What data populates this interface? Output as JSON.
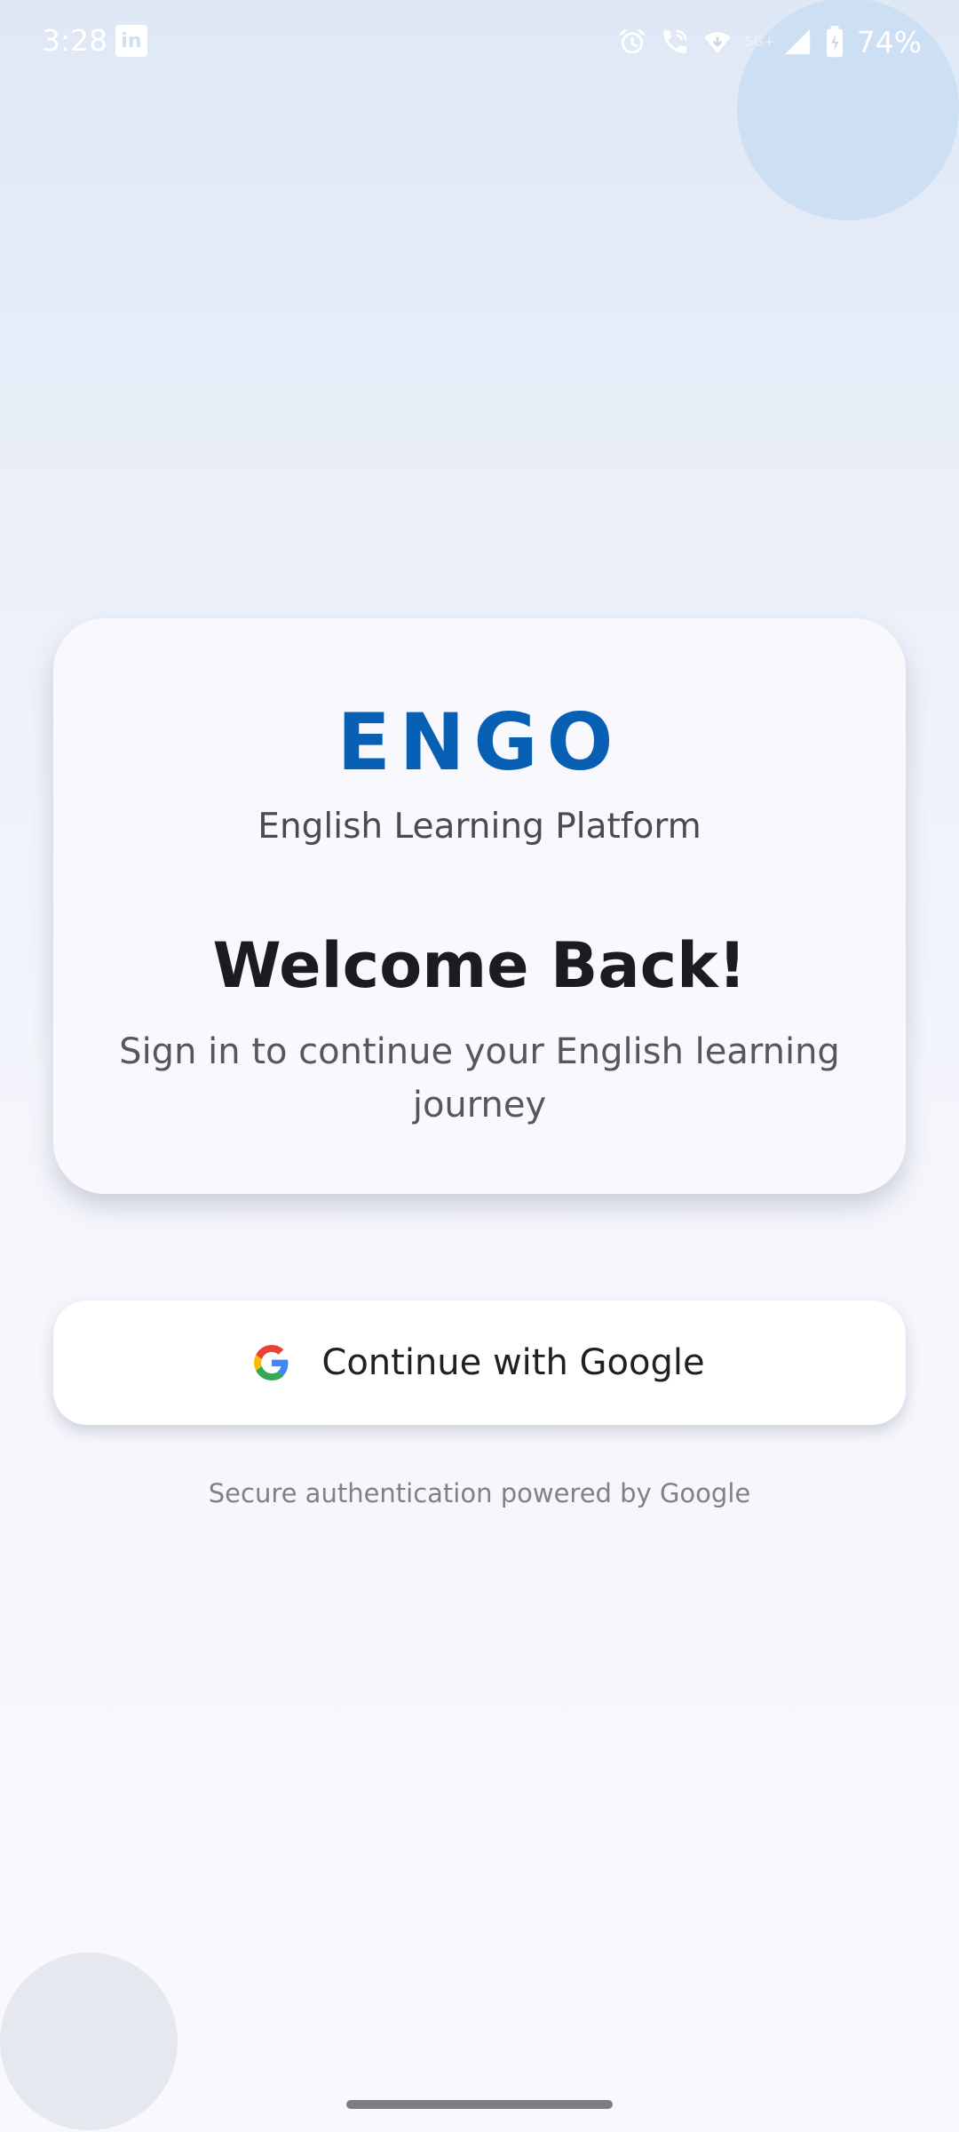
{
  "status_bar": {
    "time": "3:28",
    "notification_icon": "linkedin-icon",
    "icons": [
      "alarm-icon",
      "wifi-calling-icon",
      "data-wifi-icon",
      "signal-icon",
      "battery-icon"
    ],
    "network_type": "5G+",
    "battery_percent": "74%"
  },
  "card": {
    "logo": "ENGO",
    "subtitle": "English Learning Platform",
    "welcome": "Welcome Back!",
    "description": "Sign in to continue your English learning journey"
  },
  "google_button": {
    "icon": "google-g-icon",
    "label": "Continue with Google"
  },
  "secure_note": "Secure authentication powered by Google",
  "colors": {
    "brand": "#0860b5",
    "card_background": "#f8f8fd",
    "button_background": "#ffffff",
    "google_blue": "#4285f4",
    "google_red": "#ea4335",
    "google_yellow": "#fbbc05",
    "google_green": "#34a853"
  }
}
